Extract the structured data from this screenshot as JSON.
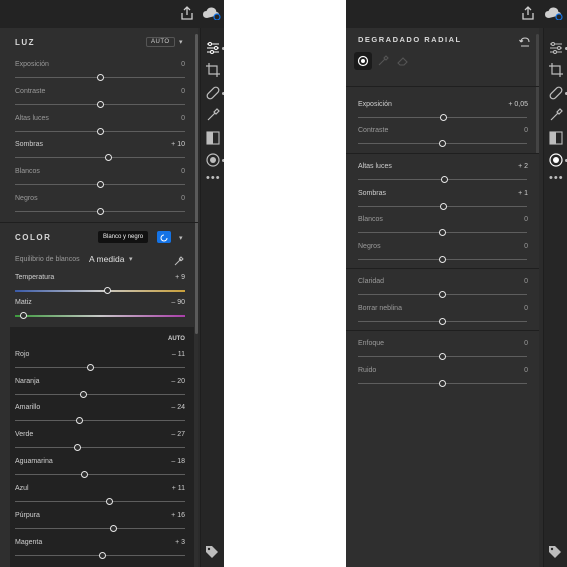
{
  "left": {
    "light": {
      "title": "LUZ",
      "auto_label": "AUTO",
      "sliders": [
        {
          "label": "Exposición",
          "value": "0",
          "pos": 0.5
        },
        {
          "label": "Contraste",
          "value": "0",
          "pos": 0.5
        },
        {
          "label": "Altas luces",
          "value": "0",
          "pos": 0.5
        },
        {
          "label": "Sombras",
          "value": "+ 10",
          "pos": 0.55
        },
        {
          "label": "Blancos",
          "value": "0",
          "pos": 0.5
        },
        {
          "label": "Negros",
          "value": "0",
          "pos": 0.5
        }
      ]
    },
    "color": {
      "title": "COLOR",
      "bw_tooltip": "Blanco y negro",
      "wb_label": "Equilibrio de blancos",
      "wb_value": "A medida",
      "temperature": {
        "label": "Temperatura",
        "value": "+ 9",
        "pos": 0.545
      },
      "tint": {
        "label": "Matiz",
        "value": "– 90",
        "pos": 0.05
      },
      "hsl_auto": "AUTO",
      "hsl": [
        {
          "label": "Rojo",
          "value": "– 11",
          "pos": 0.445
        },
        {
          "label": "Naranja",
          "value": "– 20",
          "pos": 0.4
        },
        {
          "label": "Amarillo",
          "value": "– 24",
          "pos": 0.38
        },
        {
          "label": "Verde",
          "value": "– 27",
          "pos": 0.365
        },
        {
          "label": "Aguamarina",
          "value": "– 18",
          "pos": 0.41
        },
        {
          "label": "Azul",
          "value": "+ 11",
          "pos": 0.555
        },
        {
          "label": "Púrpura",
          "value": "+ 16",
          "pos": 0.58
        },
        {
          "label": "Magenta",
          "value": "+ 3",
          "pos": 0.515
        }
      ]
    }
  },
  "right": {
    "title": "DEGRADADO RADIAL",
    "groups": [
      [
        {
          "label": "Exposición",
          "value": "+ 0,05",
          "pos": 0.503,
          "bright": true
        },
        {
          "label": "Contraste",
          "value": "0",
          "pos": 0.5,
          "bright": false
        }
      ],
      [
        {
          "label": "Altas luces",
          "value": "+ 2",
          "pos": 0.51,
          "bright": true
        },
        {
          "label": "Sombras",
          "value": "+ 1",
          "pos": 0.505,
          "bright": true
        },
        {
          "label": "Blancos",
          "value": "0",
          "pos": 0.5,
          "bright": false
        },
        {
          "label": "Negros",
          "value": "0",
          "pos": 0.5,
          "bright": false
        }
      ],
      [
        {
          "label": "Claridad",
          "value": "0",
          "pos": 0.5,
          "bright": false
        },
        {
          "label": "Borrar neblina",
          "value": "0",
          "pos": 0.5,
          "bright": false
        }
      ],
      [
        {
          "label": "Enfoque",
          "value": "0",
          "pos": 0.5,
          "bright": false
        },
        {
          "label": "Ruido",
          "value": "0",
          "pos": 0.5,
          "bright": false
        }
      ]
    ]
  },
  "colors": {
    "accent": "#1473e6",
    "panel": "#2f2f2f",
    "rail": "#262626",
    "topbar": "#232323"
  },
  "icons": {
    "topbar": [
      "share-icon",
      "cloud-sync-icon"
    ],
    "rail": [
      "edit-sliders-icon",
      "crop-icon",
      "healing-icon",
      "brush-icon",
      "linear-gradient-icon",
      "radial-gradient-icon",
      "more-icon",
      "tag-icon"
    ]
  }
}
